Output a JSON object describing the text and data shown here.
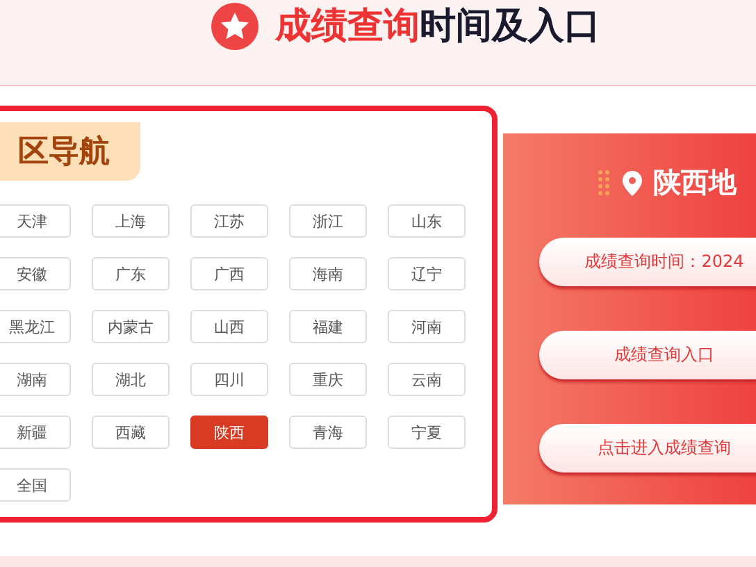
{
  "header": {
    "title_highlight": "成绩查询",
    "title_rest": "时间及入口"
  },
  "nav": {
    "title": "区导航",
    "regions": [
      {
        "label": "天津",
        "selected": false
      },
      {
        "label": "上海",
        "selected": false
      },
      {
        "label": "江苏",
        "selected": false
      },
      {
        "label": "浙江",
        "selected": false
      },
      {
        "label": "山东",
        "selected": false
      },
      {
        "label": "安徽",
        "selected": false
      },
      {
        "label": "广东",
        "selected": false
      },
      {
        "label": "广西",
        "selected": false
      },
      {
        "label": "海南",
        "selected": false
      },
      {
        "label": "辽宁",
        "selected": false
      },
      {
        "label": "黑龙江",
        "selected": false
      },
      {
        "label": "内蒙古",
        "selected": false
      },
      {
        "label": "山西",
        "selected": false
      },
      {
        "label": "福建",
        "selected": false
      },
      {
        "label": "河南",
        "selected": false
      },
      {
        "label": "湖南",
        "selected": false
      },
      {
        "label": "湖北",
        "selected": false
      },
      {
        "label": "四川",
        "selected": false
      },
      {
        "label": "重庆",
        "selected": false
      },
      {
        "label": "云南",
        "selected": false
      },
      {
        "label": "新疆",
        "selected": false
      },
      {
        "label": "西藏",
        "selected": false
      },
      {
        "label": "陕西",
        "selected": true
      },
      {
        "label": "青海",
        "selected": false
      },
      {
        "label": "宁夏",
        "selected": false
      },
      {
        "label": "全国",
        "selected": false
      }
    ]
  },
  "detail": {
    "title": "陕西地",
    "links": [
      {
        "label": "成绩查询时间：2024"
      },
      {
        "label": "成绩查询入口"
      },
      {
        "label": "点击进入成绩查询"
      }
    ]
  }
}
